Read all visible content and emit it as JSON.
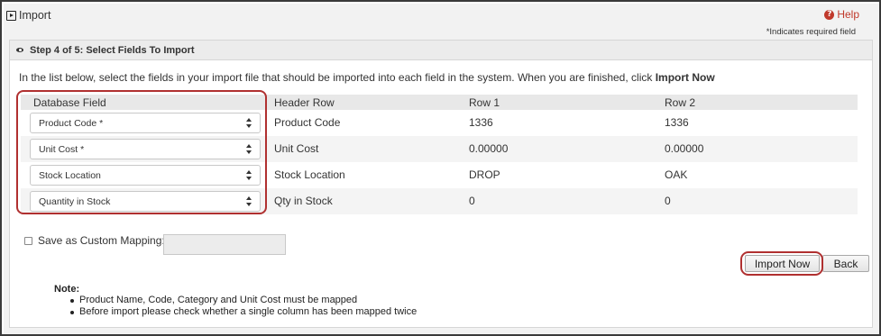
{
  "window": {
    "title": "Import",
    "help_label": "Help",
    "required_note": "*Indicates required field"
  },
  "panel": {
    "step_title": "Step 4 of 5: Select Fields To Import",
    "intro_text": "In the list below, select the fields in your import file that should be imported into each field in the system. When you are finished, click ",
    "intro_bold": "Import Now"
  },
  "table": {
    "headers": {
      "database_field": "Database Field",
      "header_row": "Header Row",
      "row1": "Row 1",
      "row2": "Row 2"
    },
    "rows": [
      {
        "field": "Product Code *",
        "header": "Product Code",
        "row1": "1336",
        "row2": "1336"
      },
      {
        "field": "Unit Cost *",
        "header": "Unit Cost",
        "row1": "0.00000",
        "row2": "0.00000"
      },
      {
        "field": "Stock Location",
        "header": "Stock Location",
        "row1": "DROP",
        "row2": "OAK"
      },
      {
        "field": "Quantity in Stock",
        "header": "Qty in Stock",
        "row1": "0",
        "row2": "0"
      }
    ]
  },
  "save_mapping": {
    "label": "Save as Custom Mapping:",
    "value": "",
    "checked": false
  },
  "buttons": {
    "import_now": "Import Now",
    "back": "Back"
  },
  "note": {
    "title": "Note:",
    "items": [
      "Product Name, Code, Category and Unit Cost must be mapped",
      "Before import please check whether a single column has been mapped twice"
    ]
  },
  "colors": {
    "highlight": "#b03030",
    "help": "#c0392b"
  }
}
